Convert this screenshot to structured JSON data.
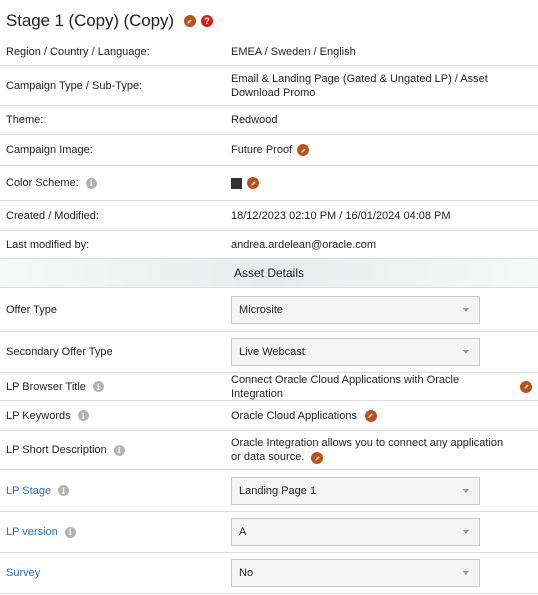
{
  "header": {
    "title": "Stage 1 (Copy) (Copy)",
    "edit_icon": "pencil-icon",
    "help_icon": "question-icon",
    "help_glyph": "?"
  },
  "details": {
    "region": {
      "label": "Region / Country / Language:",
      "value": "EMEA  /  Sweden  /  English"
    },
    "campaign_type": {
      "label": "Campaign Type / Sub-Type:",
      "value": "Email & Landing Page (Gated & Ungated LP)  /  Asset Download Promo"
    },
    "theme": {
      "label": "Theme:",
      "value": "Redwood"
    },
    "campaign_image": {
      "label": "Campaign Image:",
      "value": "Future Proof"
    },
    "color_scheme": {
      "label": "Color Scheme:",
      "swatch_color": "#333333"
    },
    "created": {
      "label": "Created / Modified:",
      "value": "18/12/2023 02:10 PM  /  16/01/2024 04:08 PM"
    },
    "last_modified_by": {
      "label": "Last modified by:",
      "value": "andrea.ardelean@oracle.com"
    }
  },
  "asset_details": {
    "heading": "Asset Details",
    "offer_type": {
      "label": "Offer Type",
      "selected": "Microsite"
    },
    "secondary_offer_type": {
      "label": "Secondary Offer Type",
      "selected": "Live Webcast"
    },
    "lp_browser_title": {
      "label": "LP Browser Title",
      "value": "Connect Oracle Cloud Applications with Oracle Integration"
    },
    "lp_keywords": {
      "label": "LP Keywords",
      "value": "Oracle Cloud Applications"
    },
    "lp_short_description": {
      "label": "LP Short Description",
      "value": "Oracle Integration allows you to connect any application or data source."
    },
    "lp_stage": {
      "label": "LP Stage",
      "selected": "Landing Page 1"
    },
    "lp_version": {
      "label": "LP version",
      "selected": "A"
    },
    "survey": {
      "label": "Survey",
      "selected": "No"
    }
  },
  "info_glyph": "i",
  "colors": {
    "accent_pencil": "#b8531e",
    "help_red": "#d41f1f",
    "link_blue": "#2a6eb8"
  }
}
